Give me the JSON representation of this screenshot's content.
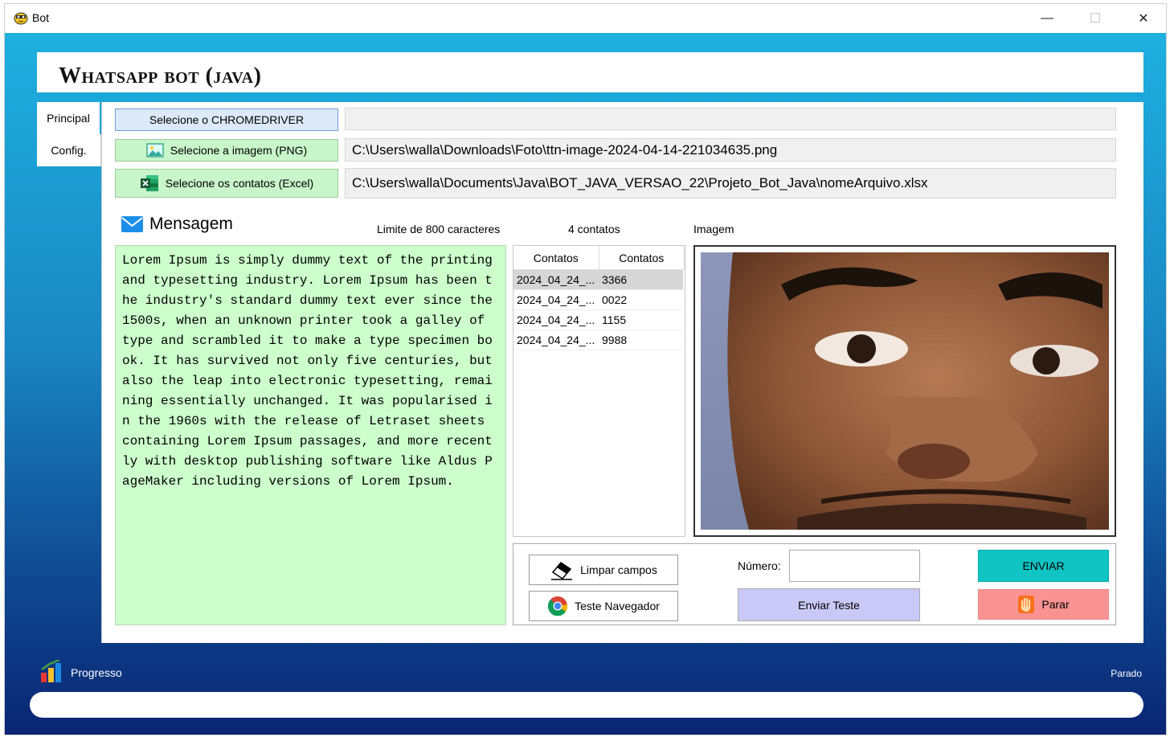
{
  "window": {
    "title": "Bot",
    "minimize": "—",
    "maximize": "☐",
    "close": "✕"
  },
  "header": {
    "title": "Whatsapp bot (java)"
  },
  "tabs": [
    {
      "label": "Principal"
    },
    {
      "label": "Config."
    }
  ],
  "files": {
    "chromedriver_label": "Selecione o CHROMEDRIVER",
    "chromedriver_path": "",
    "image_label": "Selecione a imagem (PNG)",
    "image_path": "C:\\Users\\walla\\Downloads\\Foto\\ttn-image-2024-04-14-221034635.png",
    "contacts_label": "Selecione os contatos (Excel)",
    "contacts_path": "C:\\Users\\walla\\Documents\\Java\\BOT_JAVA_VERSAO_22\\Projeto_Bot_Java\\nomeArquivo.xlsx"
  },
  "message": {
    "label": "Mensagem",
    "limit": "Limite de 800 caracteres",
    "text": "Lorem Ipsum is simply dummy text of the printing and typesetting industry. Lorem Ipsum has been the industry's standard dummy text ever since the 1500s, when an unknown printer took a galley of type and scrambled it to make a type specimen book. It has survived not only five centuries, but also the leap into electronic typesetting, remaining essentially unchanged. It was popularised in the 1960s with the release of Letraset sheets containing Lorem Ipsum passages, and more recently with desktop publishing software like Aldus PageMaker including versions of Lorem Ipsum."
  },
  "contacts": {
    "count_label": "4 contatos",
    "headers": [
      "Contatos",
      "Contatos"
    ],
    "rows": [
      {
        "c1": "2024_04_24_...",
        "c2": "3366"
      },
      {
        "c1": "2024_04_24_...",
        "c2": "0022"
      },
      {
        "c1": "2024_04_24_...",
        "c2": "1155"
      },
      {
        "c1": "2024_04_24_...",
        "c2": "9988"
      }
    ]
  },
  "image": {
    "label": "Imagem"
  },
  "actions": {
    "clear": "Limpar campos",
    "test_browser": "Teste Navegador",
    "number_label": "Número:",
    "number_value": "",
    "send": "ENVIAR",
    "send_test": "Enviar Teste",
    "stop": "Parar"
  },
  "progress": {
    "label": "Progresso",
    "status": "Parado",
    "value": 0
  },
  "colors": {
    "accent": "#1aa6da",
    "send": "#11c4c4",
    "stop": "#f99393",
    "send_test": "#c9c9f7",
    "message_bg": "#ccffcc"
  }
}
